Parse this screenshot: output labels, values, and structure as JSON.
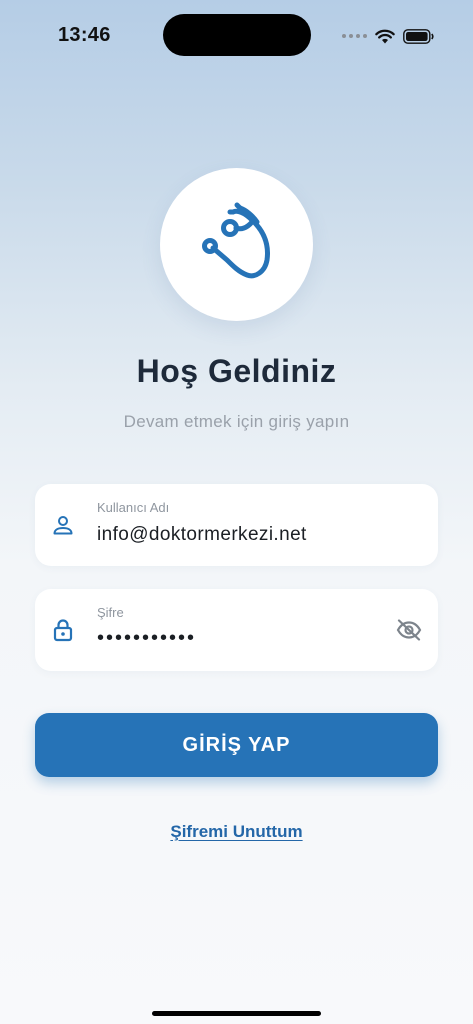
{
  "status_bar": {
    "time": "13:46",
    "icons": [
      "signal-dots-icon",
      "wifi-icon",
      "battery-icon"
    ]
  },
  "brand": {
    "logo_icon": "stethoscope-icon",
    "accent_color": "#2673b7"
  },
  "header": {
    "title": "Hoş Geldiniz",
    "subtitle": "Devam etmek için giriş yapın"
  },
  "form": {
    "username": {
      "label": "Kullanıcı Adı",
      "value": "info@doktormerkezi.net",
      "icon": "person-icon"
    },
    "password": {
      "label": "Şifre",
      "value": "•••••••••••",
      "icon": "lock-icon",
      "toggle_icon": "eye-off-icon"
    },
    "submit_label": "GİRİŞ YAP",
    "forgot_label": "Şifremi Unuttum"
  }
}
